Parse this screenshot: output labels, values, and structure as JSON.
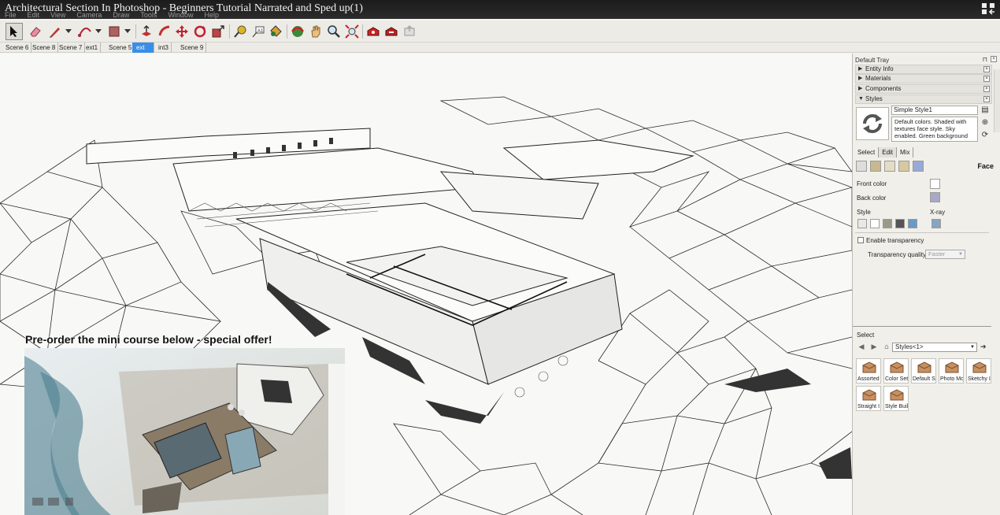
{
  "window": {
    "title": "Architectural Section In Photoshop - Beginners Tutorial Narrated and Sped up(1)"
  },
  "menu": [
    "File",
    "Edit",
    "View",
    "Camera",
    "Draw",
    "Tools",
    "Window",
    "Help"
  ],
  "toolbar": {
    "tools": [
      "select-icon",
      "eraser-icon",
      "pencil-icon",
      "arc-icon",
      "shape-icon",
      "push-pull-icon",
      "follow-me-icon",
      "move-icon",
      "rotate-icon",
      "scale-icon",
      "tape-measure-icon",
      "text-icon",
      "paint-bucket-icon",
      "orbit-icon",
      "pan-icon",
      "zoom-icon",
      "zoom-extents-icon",
      "warehouse-icon",
      "extension-icon",
      "share-model-icon"
    ]
  },
  "scenes": {
    "tabs": [
      "Scene 6",
      "Scene 8",
      "Scene 7",
      "ext1",
      "Scene 5",
      "ext",
      "int3",
      "Scene 9"
    ],
    "active": "ext"
  },
  "promo": {
    "text": "Pre-order the mini course below - special offer!"
  },
  "tray": {
    "title": "Default Tray",
    "sections": [
      {
        "label": "Entity Info",
        "expanded": false
      },
      {
        "label": "Materials",
        "expanded": false
      },
      {
        "label": "Components",
        "expanded": false
      },
      {
        "label": "Styles",
        "expanded": true
      }
    ],
    "styles": {
      "name": "Simple Style1",
      "description": "Default colors. Shaded with textures face style. Sky enabled. Green background",
      "tabs": [
        "Select",
        "Edit",
        "Mix"
      ],
      "active_tab": "Edit",
      "face_heading": "Face",
      "front_color_label": "Front color",
      "back_color_label": "Back color",
      "front_color": "#ffffff",
      "back_color": "#a9a8c8",
      "style_label": "Style",
      "xray_label": "X-ray",
      "enable_transparency": "Enable transparency",
      "transparency_quality_label": "Transparency quality:",
      "transparency_quality_value": "Faster"
    },
    "select": {
      "title": "Select",
      "library": "Styles<1>",
      "items": [
        "Assorted",
        "Color Set",
        "Default S",
        "Photo Mo",
        "Sketchy I",
        "Straight I",
        "Style Buil"
      ]
    }
  }
}
